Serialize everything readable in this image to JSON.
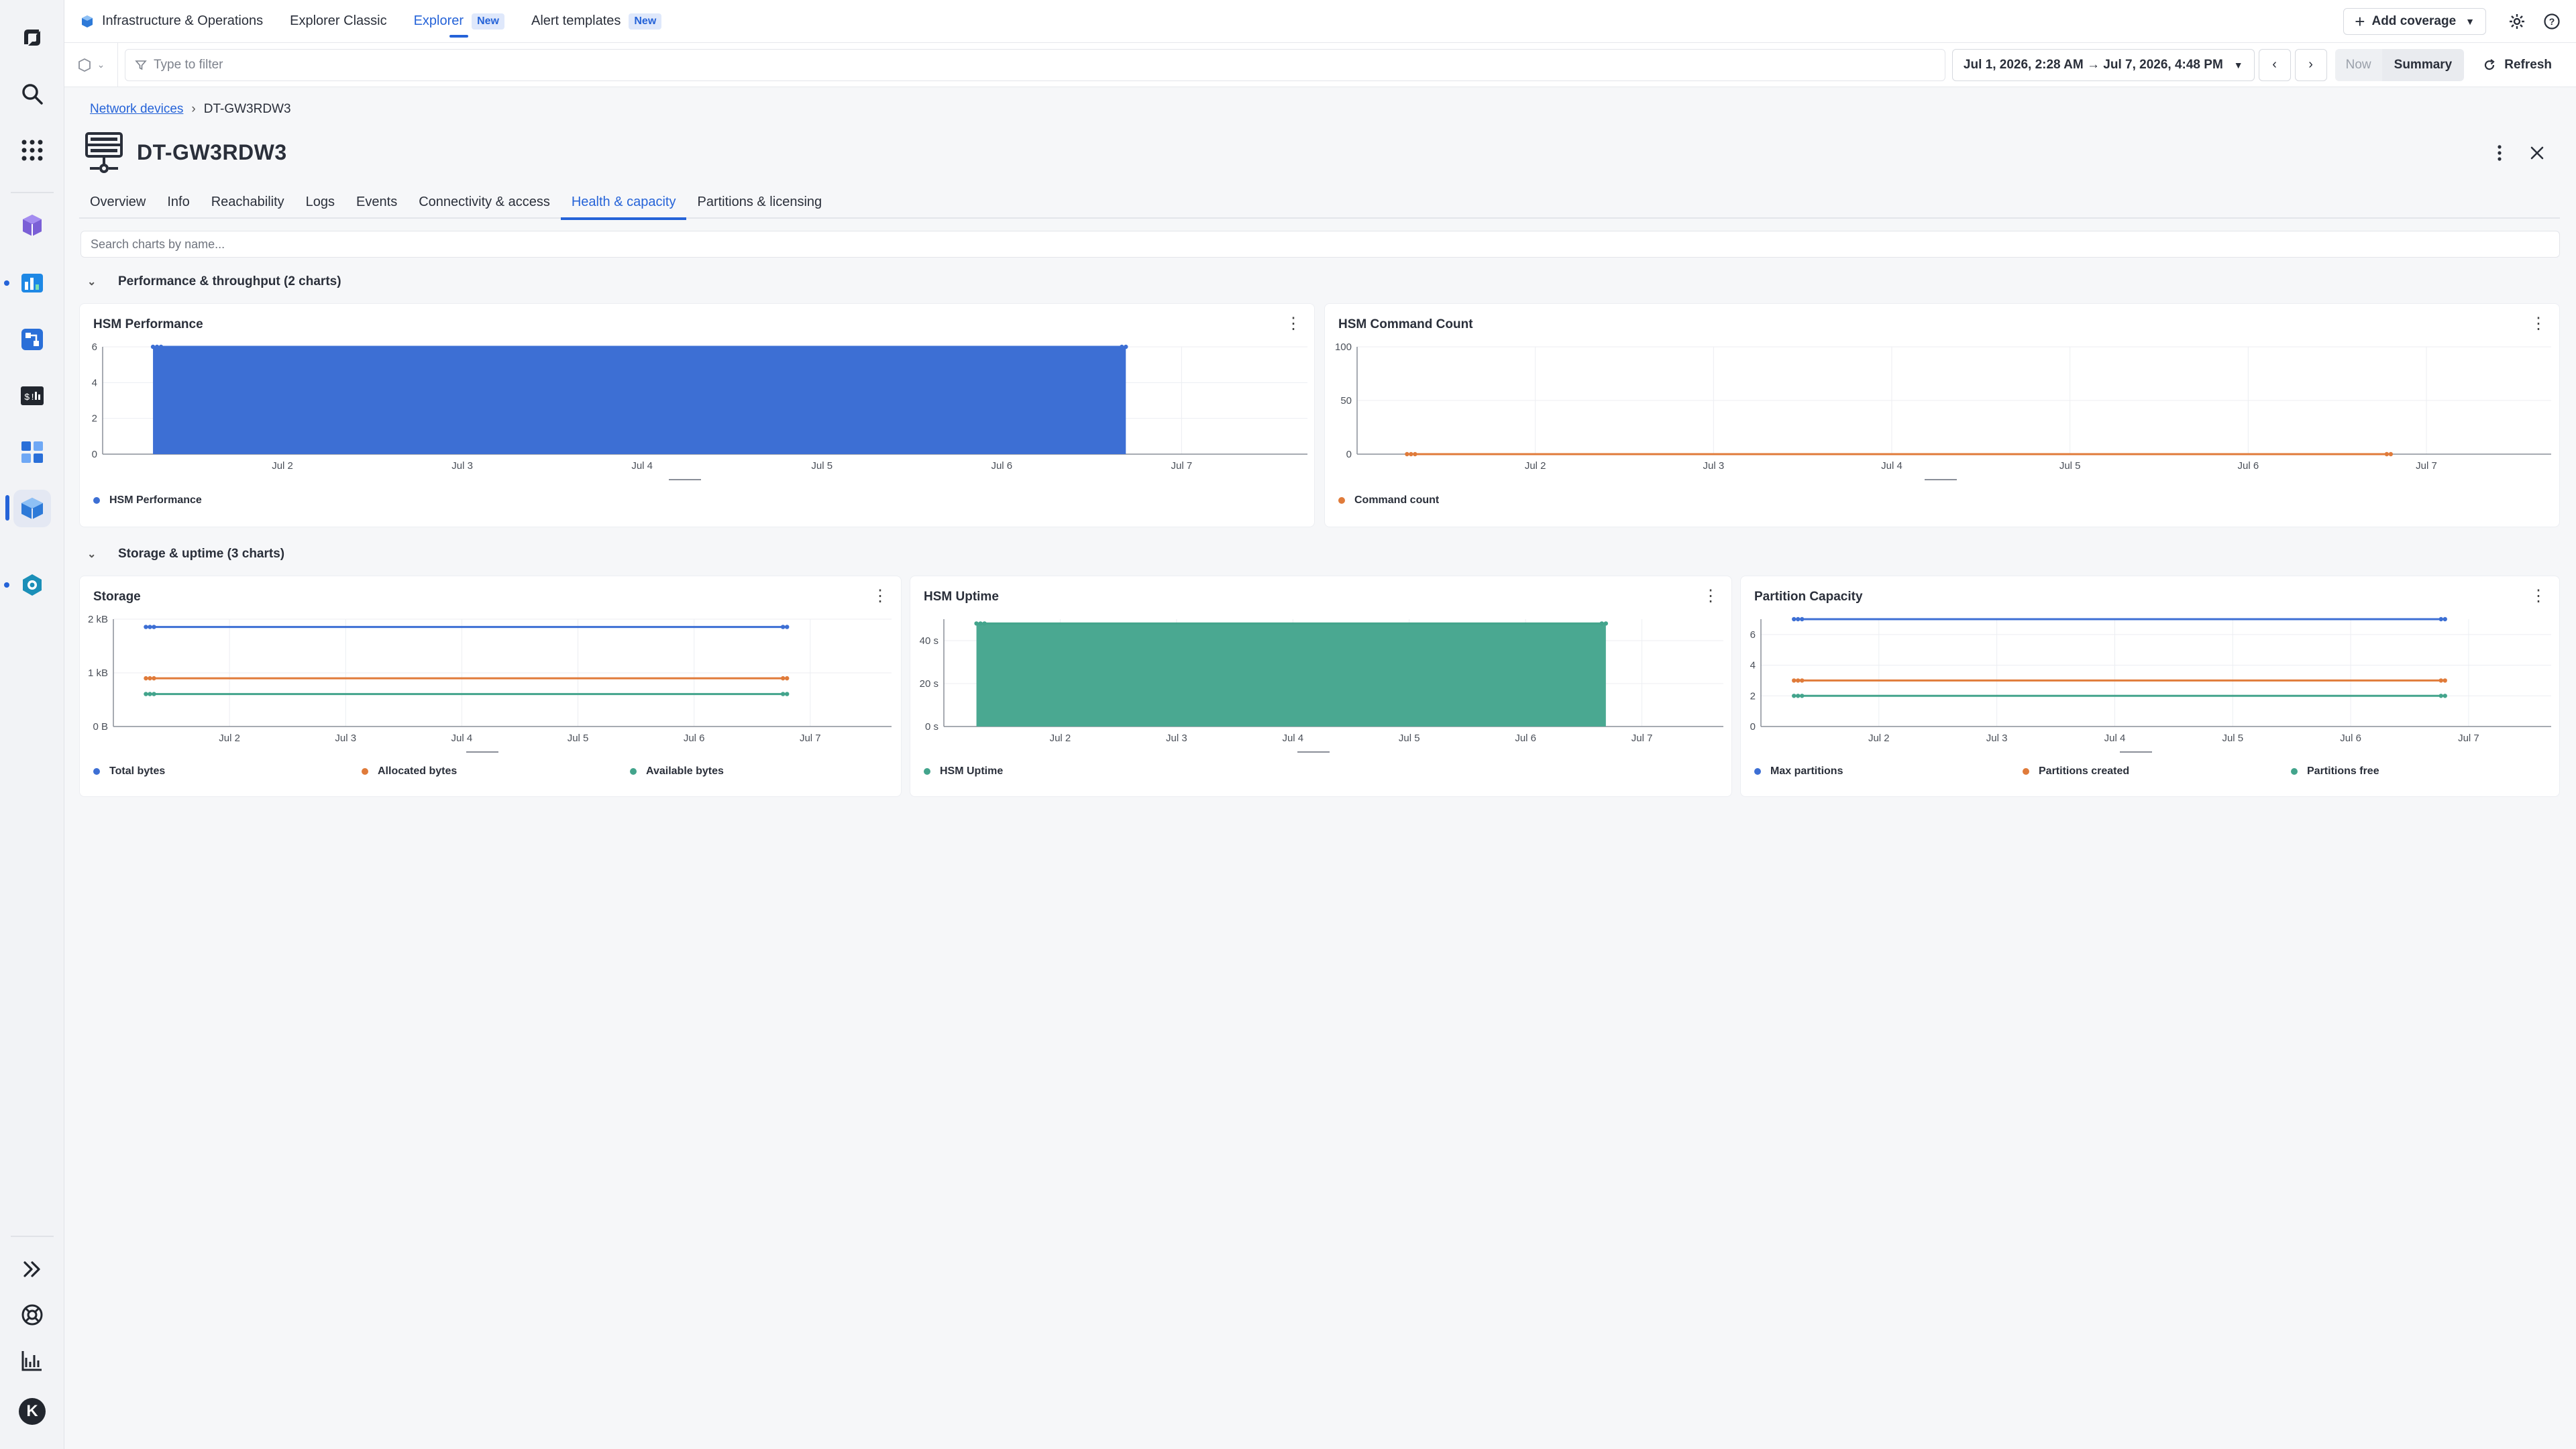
{
  "topnav": {
    "app_name": "Infrastructure & Operations",
    "tabs": [
      {
        "label": "Explorer Classic",
        "badge": ""
      },
      {
        "label": "Explorer",
        "badge": "New",
        "active": true
      },
      {
        "label": "Alert templates",
        "badge": "New"
      }
    ],
    "add_coverage": "Add coverage"
  },
  "filterbar": {
    "filter_placeholder": "Type to filter",
    "timeframe": "Jul 1, 2026, 2:28 AM → Jul 7, 2026, 4:48 PM",
    "now": "Now",
    "summary": "Summary",
    "refresh": "Refresh"
  },
  "breadcrumb": {
    "parent": "Network devices",
    "current": "DT-GW3RDW3"
  },
  "page": {
    "title": "DT-GW3RDW3",
    "tabs": [
      "Overview",
      "Info",
      "Reachability",
      "Logs",
      "Events",
      "Connectivity & access",
      "Health & capacity",
      "Partitions & licensing"
    ],
    "active_tab": "Health & capacity",
    "chart_search_placeholder": "Search charts by name..."
  },
  "sections": [
    {
      "title": "Performance & throughput (2 charts)"
    },
    {
      "title": "Storage & uptime (3 charts)"
    }
  ],
  "colors": {
    "accent": "#2563d8",
    "blue": "#3d6fd4",
    "orange": "#e07b3a",
    "teal": "#43a48c"
  },
  "chart_data": [
    {
      "id": "hsm-performance",
      "type": "area",
      "title": "HSM Performance",
      "x_ticks": [
        "Jul 2",
        "Jul 3",
        "Jul 4",
        "Jul 5",
        "Jul 6",
        "Jul 7"
      ],
      "y_ticks": [
        "0",
        "2",
        "4",
        "6"
      ],
      "ylim": [
        0,
        6
      ],
      "x_range": [
        1.0,
        7.7
      ],
      "series": [
        {
          "name": "HSM Performance",
          "color": "#3d6fd4",
          "fill": "#3d6fd4",
          "x_start": 1.28,
          "x_end": 6.69,
          "value": 6
        }
      ]
    },
    {
      "id": "hsm-command-count",
      "type": "line",
      "title": "HSM Command Count",
      "x_ticks": [
        "Jul 2",
        "Jul 3",
        "Jul 4",
        "Jul 5",
        "Jul 6",
        "Jul 7"
      ],
      "y_ticks": [
        "0",
        "50",
        "100"
      ],
      "ylim": [
        0,
        100
      ],
      "x_range": [
        1.0,
        7.7
      ],
      "series": [
        {
          "name": "Command count",
          "color": "#e07b3a",
          "x_start": 1.28,
          "x_end": 6.8,
          "value": 0
        }
      ]
    },
    {
      "id": "storage",
      "type": "line",
      "title": "Storage",
      "x_ticks": [
        "Jul 2",
        "Jul 3",
        "Jul 4",
        "Jul 5",
        "Jul 6",
        "Jul 7"
      ],
      "y_ticks": [
        "0 B",
        "1 kB",
        "2 kB"
      ],
      "ylim": [
        0,
        2048
      ],
      "x_range": [
        1.0,
        7.7
      ],
      "series": [
        {
          "name": "Total bytes",
          "color": "#3d6fd4",
          "x_start": 1.28,
          "x_end": 6.8,
          "value": 1900
        },
        {
          "name": "Allocated bytes",
          "color": "#e07b3a",
          "x_start": 1.28,
          "x_end": 6.8,
          "value": 920
        },
        {
          "name": "Available bytes",
          "color": "#43a48c",
          "x_start": 1.28,
          "x_end": 6.8,
          "value": 620
        }
      ]
    },
    {
      "id": "hsm-uptime",
      "type": "area",
      "title": "HSM Uptime",
      "x_ticks": [
        "Jul 2",
        "Jul 3",
        "Jul 4",
        "Jul 5",
        "Jul 6",
        "Jul 7"
      ],
      "y_ticks": [
        "0 s",
        "20 s",
        "40 s"
      ],
      "ylim": [
        0,
        50
      ],
      "x_range": [
        1.0,
        7.7
      ],
      "series": [
        {
          "name": "HSM Uptime",
          "color": "#43a48c",
          "fill": "#4aa891",
          "x_start": 1.28,
          "x_end": 6.69,
          "value": 48
        }
      ]
    },
    {
      "id": "partition-capacity",
      "type": "line",
      "title": "Partition Capacity",
      "x_ticks": [
        "Jul 2",
        "Jul 3",
        "Jul 4",
        "Jul 5",
        "Jul 6",
        "Jul 7"
      ],
      "y_ticks": [
        "0",
        "2",
        "4",
        "6"
      ],
      "ylim": [
        0,
        7
      ],
      "x_range": [
        1.0,
        7.7
      ],
      "series": [
        {
          "name": "Max partitions",
          "color": "#3d6fd4",
          "x_start": 1.28,
          "x_end": 6.8,
          "value": 7
        },
        {
          "name": "Partitions created",
          "color": "#e07b3a",
          "x_start": 1.28,
          "x_end": 6.8,
          "value": 3
        },
        {
          "name": "Partitions free",
          "color": "#43a48c",
          "x_start": 1.28,
          "x_end": 6.8,
          "value": 2
        }
      ]
    }
  ]
}
